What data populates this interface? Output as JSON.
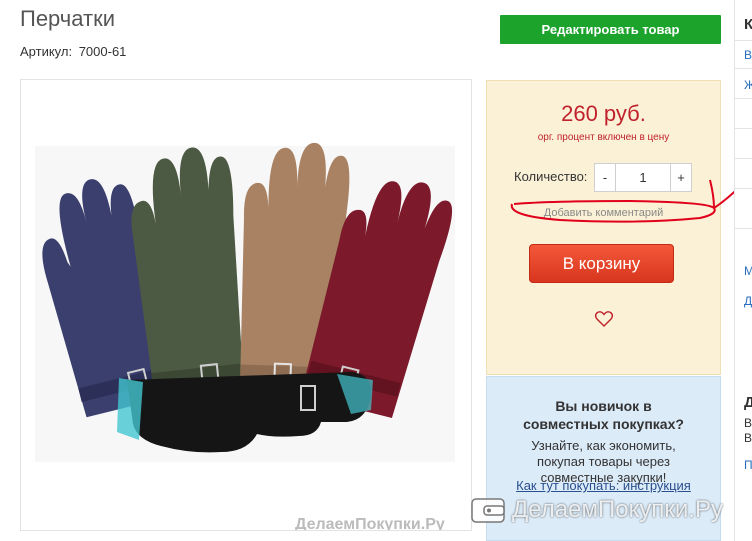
{
  "product": {
    "title": "Перчатки",
    "article_label": "Артикул:",
    "article_value": "7000-61"
  },
  "edit_button_label": "Редактировать товар",
  "buy_box": {
    "price": "260 руб.",
    "price_note": "орг. процент включен в цену",
    "quantity_label": "Количество:",
    "quantity_value": "1",
    "minus_label": "-",
    "plus_label": "+",
    "add_comment": "Добавить комментарий",
    "cart_button": "В корзину",
    "favorite_icon": "heart-icon"
  },
  "novice_box": {
    "heading": "Вы новичок в совместных покупках?",
    "text": "Узнайте, как экономить, покупая товары через совместные закупки!",
    "link": "Как тут покупать: инструкция"
  },
  "photo_watermark": "ДелаемПокупки.Ру",
  "site_watermark": "ДелаемПокупки.Ру",
  "right_column": {
    "items": [
      "К",
      "В",
      "Ж",
      "М",
      "Д",
      "Д",
      "В",
      "В",
      "П"
    ]
  },
  "colors": {
    "edit_button": "#1ba32c",
    "price": "#c0222d",
    "cart_button": "#e2472a",
    "buy_box_bg": "#fbf1d6",
    "novice_bg": "#dcebf8",
    "annotation": "#e0001b"
  }
}
